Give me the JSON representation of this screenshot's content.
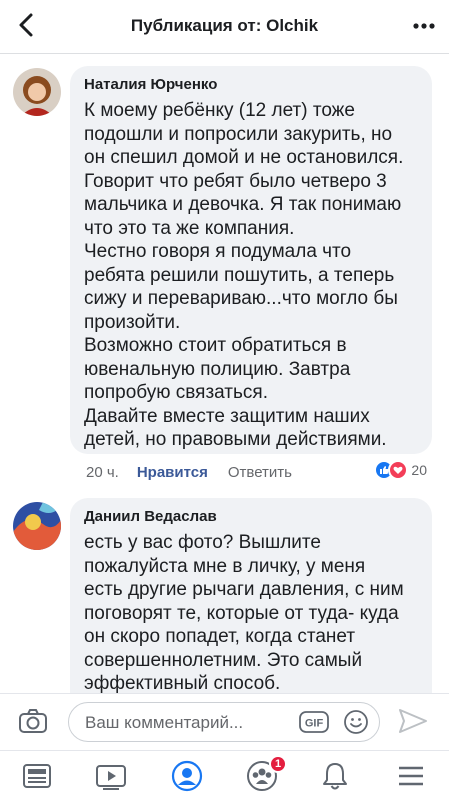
{
  "header": {
    "title": "Публикация от: Olchik",
    "back_icon": "chevron-left-icon",
    "more_icon": "more-dots-icon"
  },
  "comments": [
    {
      "author": "Наталия Юрченко",
      "text": "К моему ребёнку (12 лет) тоже\nподошли и попросили закурить, но\nон спешил домой и не остановился.\nГоворит что ребят было четверо 3\nмальчика и девочка. Я так понимаю\nчто это та же компания.\nЧестно говоря я подумала что\nребята решили пошутить, а теперь\nсижу и перевариваю...что могло бы\nпроизойти.\nВозможно стоит обратиться в\nювенальную полицию. Завтра\nпопробую связаться.\nДавайте вместе защитим наших\nдетей, но правовыми действиями.",
      "time": "20 ч.",
      "like_label": "Нравится",
      "reply_label": "Ответить",
      "reaction_count": "20"
    },
    {
      "author": "Даниил Ведаслав",
      "text": "есть у вас фото? Вышлите\nпожалуйста мне в личку, у меня\nесть другие рычаги давления, с ним\nпоговорят те, которые от туда- куда\nон скоро попадет, когда станет\nсовершеннолетним. Это самый\nэффективный способ."
    }
  ],
  "composer": {
    "placeholder": "Ваш комментарий...",
    "gif_label": "GIF"
  },
  "tabbar": {
    "icons": [
      "news-feed-icon",
      "watch-video-icon",
      "profile-icon",
      "groups-icon",
      "notifications-bell-icon",
      "menu-icon"
    ],
    "groups_badge": "1"
  },
  "colors": {
    "accent": "#3b5998",
    "bubble": "#f0f2f5",
    "badge": "#e41e3f",
    "like_reaction": "#1877f2",
    "love_reaction": "#f33e58"
  }
}
